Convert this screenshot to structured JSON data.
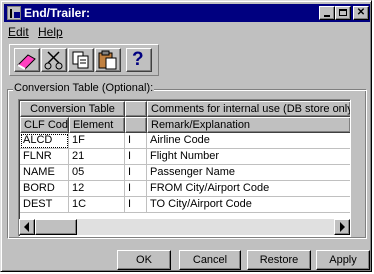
{
  "window": {
    "title": "End/Trailer:"
  },
  "menu": {
    "edit_label": "Edit",
    "help_label": "Help"
  },
  "toolbar": {
    "buttons": [
      "eraser-icon",
      "scissors-icon",
      "copy-icon",
      "paste-icon",
      "help-question-icon"
    ],
    "help_glyph": "?"
  },
  "group": {
    "label": "Conversion Table (Optional):",
    "header_top": [
      "Conversion Table",
      "",
      "Comments for internal use (DB store only)"
    ],
    "columns": [
      "CLF Code",
      "Element",
      "",
      "Remark/Explanation"
    ],
    "rows": [
      [
        "ALCD",
        "1F",
        "I",
        "Airline Code"
      ],
      [
        "FLNR",
        "21",
        "I",
        "Flight Number"
      ],
      [
        "NAME",
        "05",
        "I",
        "Passenger Name"
      ],
      [
        "BORD",
        "12",
        "I",
        "FROM City/Airport Code"
      ],
      [
        "DEST",
        "1C",
        "I",
        "TO City/Airport Code"
      ]
    ]
  },
  "buttons": {
    "ok": "OK",
    "cancel": "Cancel",
    "restore": "Restore",
    "apply": "Apply"
  },
  "colors": {
    "titlebar": "#000080",
    "face": "#c0c0c0"
  }
}
